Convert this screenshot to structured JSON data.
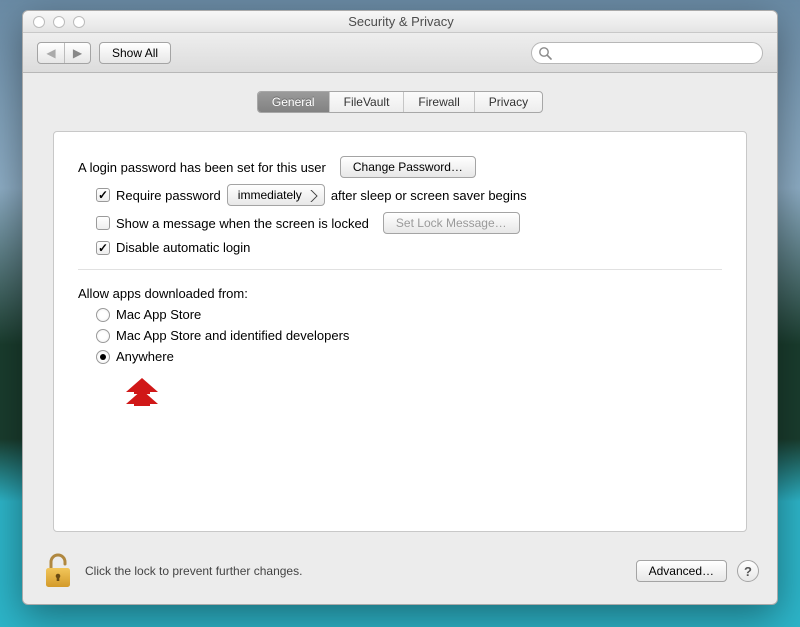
{
  "window": {
    "title": "Security & Privacy"
  },
  "toolbar": {
    "show_all": "Show All",
    "search_placeholder": ""
  },
  "tabs": [
    "General",
    "FileVault",
    "Firewall",
    "Privacy"
  ],
  "active_tab": 0,
  "login": {
    "text": "A login password has been set for this user",
    "change_btn": "Change Password…",
    "require_label_pre": "Require password",
    "require_select": "immediately",
    "require_label_post": "after sleep or screen saver begins",
    "require_checked": true,
    "message_label": "Show a message when the screen is locked",
    "message_checked": false,
    "message_btn": "Set Lock Message…",
    "disable_autologin": "Disable automatic login",
    "disable_checked": true
  },
  "gatekeeper": {
    "heading": "Allow apps downloaded from:",
    "options": [
      "Mac App Store",
      "Mac App Store and identified developers",
      "Anywhere"
    ],
    "selected": 2
  },
  "footer": {
    "lock_text": "Click the lock to prevent further changes.",
    "advanced": "Advanced…"
  },
  "colors": {
    "annotation": "#d01818"
  }
}
